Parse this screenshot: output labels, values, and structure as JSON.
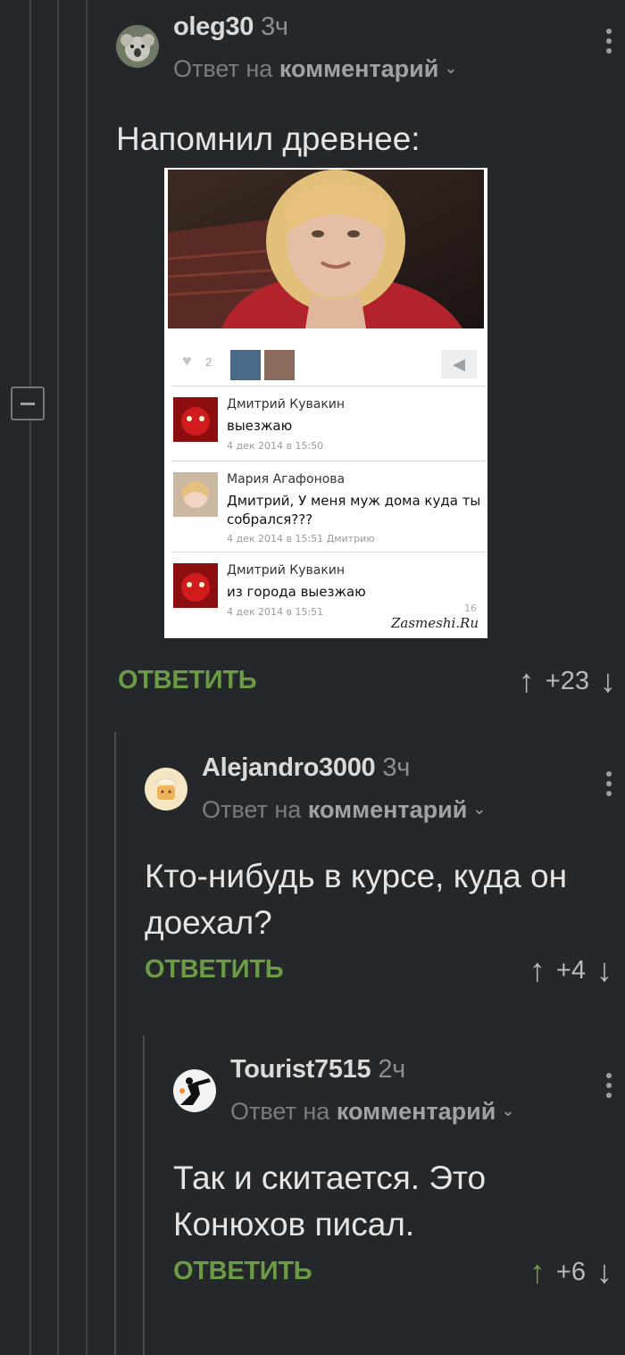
{
  "comments": [
    {
      "author": "oleg30",
      "time": "3ч",
      "reply_prefix": "Ответ на",
      "reply_target": "комментарий",
      "text": "Напомнил древнее:",
      "reply_label": "ОТВЕТИТЬ",
      "rating": "+23",
      "upvoted": false
    },
    {
      "author": "Alejandro3000",
      "time": "3ч",
      "reply_prefix": "Ответ на",
      "reply_target": "комментарий",
      "text": "Кто-нибудь в курсе, куда он доехал?",
      "reply_label": "ОТВЕТИТЬ",
      "rating": "+4",
      "upvoted": false
    },
    {
      "author": "Tourist7515",
      "time": "2ч",
      "reply_prefix": "Ответ на",
      "reply_target": "комментарий",
      "text": "Так и скитается. Это Конюхов писал.",
      "reply_label": "ОТВЕТИТЬ",
      "rating": "+6",
      "upvoted": true
    }
  ],
  "image": {
    "likes": "2",
    "posts": [
      {
        "name": "Дмитрий Кувакин",
        "message": "выезжаю",
        "date": "4 дек 2014 в 15:50",
        "to": ""
      },
      {
        "name": "Мария Агафонова",
        "message": "Дмитрий, У меня муж дома куда ты собрался???",
        "date": "4 дек 2014 в 15:51",
        "to": "Дмитрию"
      },
      {
        "name": "Дмитрий Кувакин",
        "message": "из города выезжаю",
        "date": "4 дек 2014 в 15:51",
        "to": ""
      }
    ],
    "last_likes": "16",
    "watermark": "Zasmeshi.Ru"
  },
  "colors": {
    "background": "#25282a",
    "accent_green": "#6b9b45",
    "text": "#e4e5e6"
  },
  "icons": [
    "collapse-icon",
    "more-icon",
    "chevron-down-icon",
    "arrow-up-icon",
    "arrow-down-icon",
    "heart-icon",
    "megaphone-icon"
  ]
}
